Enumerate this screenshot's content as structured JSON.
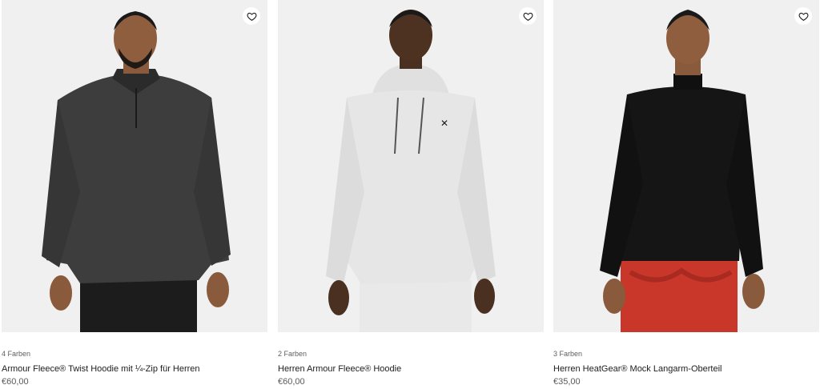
{
  "products": [
    {
      "colors": "4 Farben",
      "title": "Armour Fleece® Twist Hoodie mit ¼-Zip für Herren",
      "price": "€60,00",
      "garment_color": "#3b3b3b",
      "icon": "heart-icon"
    },
    {
      "colors": "2 Farben",
      "title": "Herren Armour Fleece® Hoodie",
      "price": "€60,00",
      "garment_color": "#e6e6e6",
      "icon": "heart-icon"
    },
    {
      "colors": "3 Farben",
      "title": "Herren HeatGear® Mock Langarm-Oberteil",
      "price": "€35,00",
      "garment_color": "#141414",
      "icon": "heart-icon"
    }
  ]
}
